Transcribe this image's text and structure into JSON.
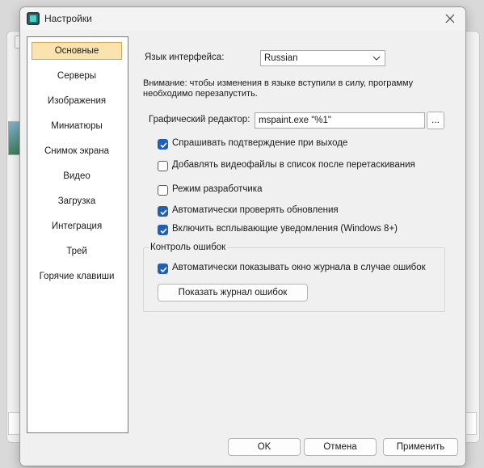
{
  "window": {
    "title": "Настройки"
  },
  "sidebar": {
    "items": [
      {
        "label": "Основные",
        "active": true
      },
      {
        "label": "Серверы",
        "active": false
      },
      {
        "label": "Изображения",
        "active": false
      },
      {
        "label": "Миниатюры",
        "active": false
      },
      {
        "label": "Снимок экрана",
        "active": false
      },
      {
        "label": "Видео",
        "active": false
      },
      {
        "label": "Загрузка",
        "active": false
      },
      {
        "label": "Интеграция",
        "active": false
      },
      {
        "label": "Трей",
        "active": false
      },
      {
        "label": "Горячие клавиши",
        "active": false
      }
    ]
  },
  "general": {
    "language_label": "Язык интерфейса:",
    "language_value": "Russian",
    "restart_note": "Внимание: чтобы изменения в языке вступили в силу, программу необходимо перезапустить.",
    "editor_label": "Графический редактор:",
    "editor_value": "mspaint.exe \"%1\"",
    "browse_label": "...",
    "checkboxes": [
      {
        "label": "Спрашивать подтверждение при выходе",
        "checked": true
      },
      {
        "label": "Добавлять видеофайлы в список после перетаскивания",
        "checked": false
      },
      {
        "label": "Режим разработчика",
        "checked": false
      },
      {
        "label": "Автоматически проверять обновления",
        "checked": true
      },
      {
        "label": "Включить всплывающие уведомления (Windows 8+)",
        "checked": true
      }
    ]
  },
  "errors_group": {
    "title": "Контроль ошибок",
    "auto_show_label": "Автоматически показывать окно журнала в случае ошибок",
    "auto_show_checked": true,
    "show_log_button": "Показать журнал ошибок"
  },
  "footer": {
    "ok_label": "OK",
    "cancel_label": "Отмена",
    "apply_label": "Применить"
  },
  "colors": {
    "accent": "#1f5fb8",
    "active_item_bg": "#fbe3b0"
  }
}
